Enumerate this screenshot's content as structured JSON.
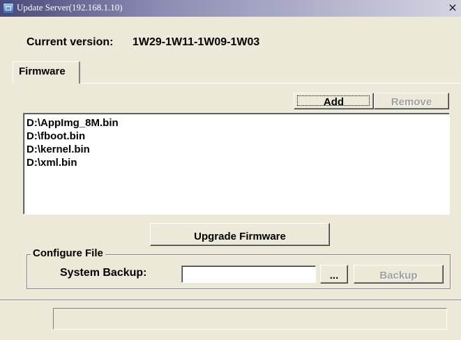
{
  "window": {
    "title": "Update Server(192.168.1.10)",
    "close_glyph": "×"
  },
  "version": {
    "label": "Current version:",
    "value": "1W29-1W11-1W09-1W03"
  },
  "tabs": [
    {
      "label": "Firmware",
      "selected": true
    }
  ],
  "firmware": {
    "add_label": "Add",
    "remove_label": "Remove",
    "files": [
      "D:\\AppImg_8M.bin",
      "D:\\fboot.bin",
      "D:\\kernel.bin",
      "D:\\xml.bin"
    ],
    "upgrade_label": "Upgrade Firmware"
  },
  "configure": {
    "group_label": "Configure File",
    "backup_label": "System Backup:",
    "backup_path_value": "",
    "browse_label": "...",
    "backup_button_label": "Backup"
  },
  "status": {
    "text": ""
  },
  "icons": {
    "app": "app-window-icon",
    "close": "close-icon"
  }
}
